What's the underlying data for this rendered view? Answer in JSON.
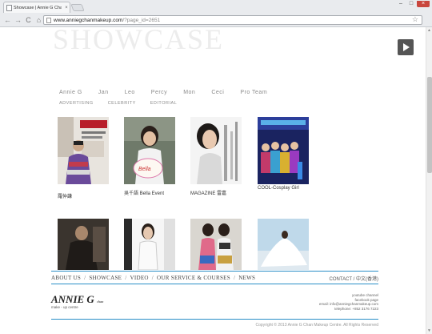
{
  "browser": {
    "tab_title": "Showcase | Annie G Chan",
    "tab_close": "×",
    "url_host": "www.anniegchanmakeup.com",
    "url_path": "/?page_id=2651",
    "back": "←",
    "forward": "→",
    "reload": "C",
    "home": "⌂",
    "bookmark": "☆",
    "min": "–",
    "max": "□",
    "close": "×"
  },
  "page": {
    "title": "SHOWCASE",
    "artists": [
      "Annie G",
      "Jan",
      "Leo",
      "Percy",
      "Mon",
      "Ceci",
      "Pro Team"
    ],
    "categories": [
      "ADVERTISING",
      "CELEBRITY",
      "EDITORIAL"
    ],
    "items": [
      {
        "caption": "羅仲謙"
      },
      {
        "caption": "吳千語 Bella Event"
      },
      {
        "caption": "MAGAZINE 雷嘉"
      },
      {
        "caption": "COOL-Cosplay Girl"
      },
      {
        "caption": ""
      },
      {
        "caption": ""
      },
      {
        "caption": ""
      },
      {
        "caption": ""
      }
    ]
  },
  "footer": {
    "nav": [
      "ABOUT US",
      "SHOWCASE",
      "VIDEO",
      "OUR SERVICE & COURSES",
      "NEWS"
    ],
    "contact": "CONTACT  /  中文(香港)",
    "logo_main": "ANNIE G",
    "logo_dotcom": "chan",
    "logo_sub": "make - up centre",
    "info": [
      "youtube channel",
      "facebook page",
      "email: info@anniegchanmakeup.com",
      "telephone: +852 3176 7223"
    ],
    "copyright": "Copyright © 2013 Annie G Chan Makeup Centre. All Rights Reserved"
  },
  "colors": {
    "accent": "#2a8fc7"
  }
}
